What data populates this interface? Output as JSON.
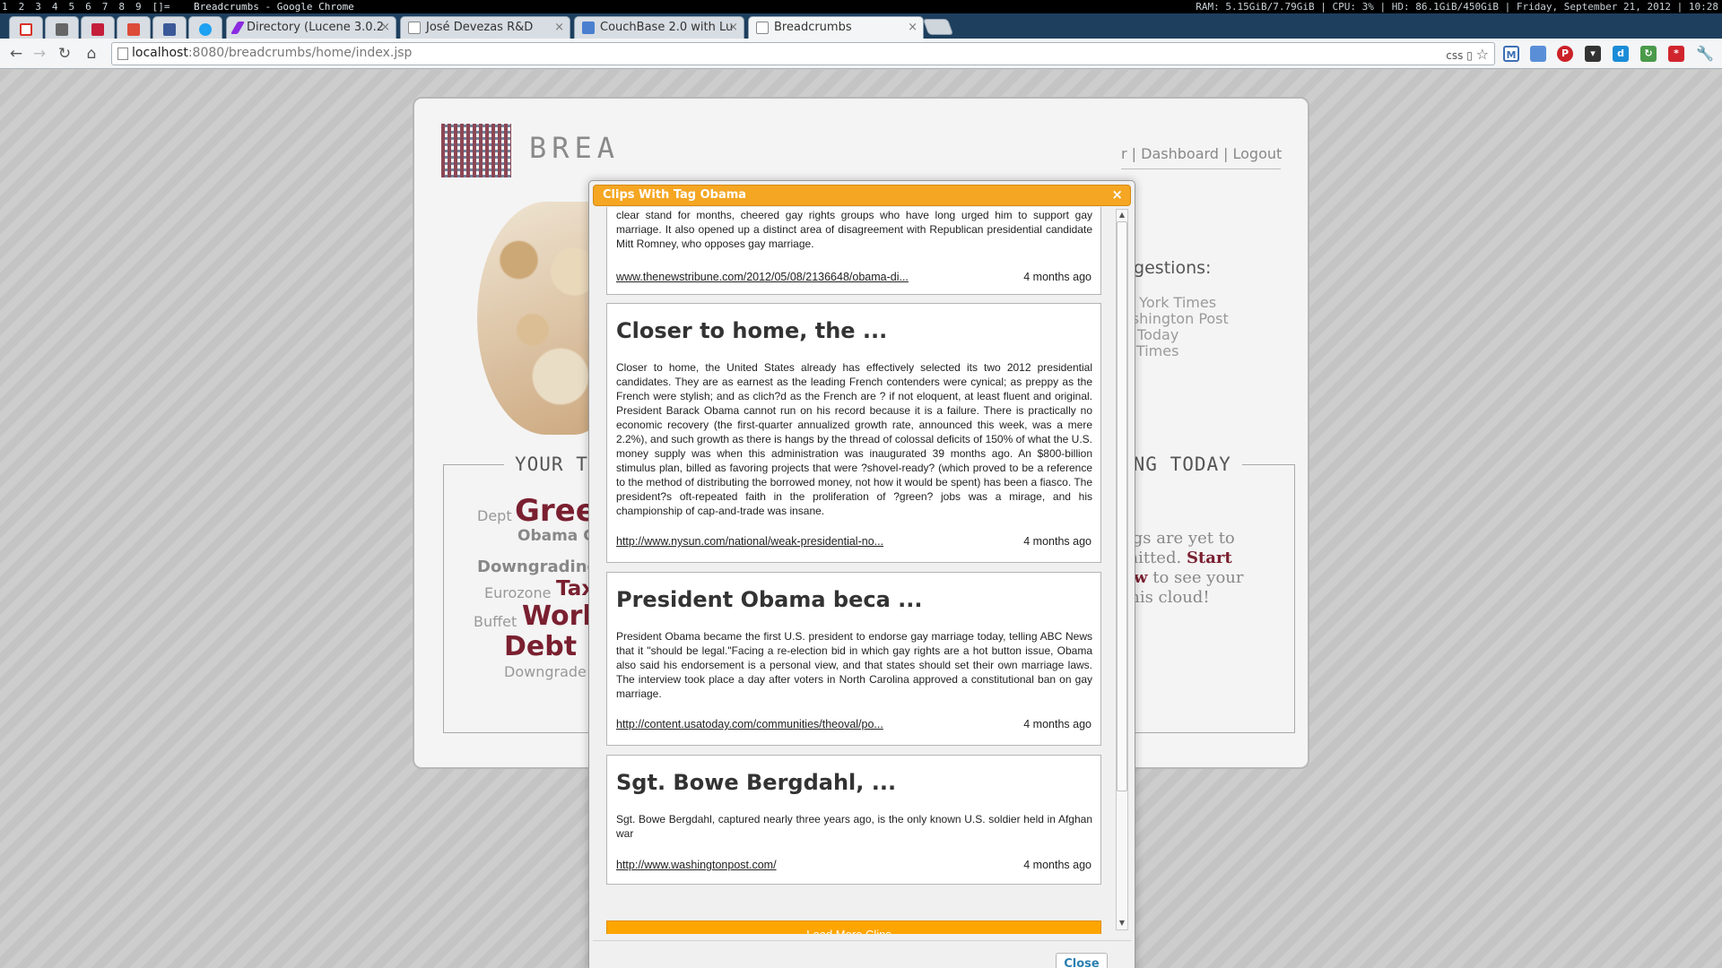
{
  "wm": {
    "workspaces": [
      "1",
      "2",
      "3",
      "4",
      "5",
      "6",
      "7",
      "8",
      "9",
      "[]="
    ],
    "window_title": "Breadcrumbs - Google Chrome",
    "status": "RAM: 5.15GiB/7.79GiB | CPU: 3% | HD: 86.1GiB/450GiB | Friday, September 21, 2012 | 10:28"
  },
  "tabs": [
    {
      "label": "",
      "icon": "gmail-icon",
      "color": "#d93025"
    },
    {
      "label": "",
      "icon": "calendar-icon",
      "color": "#555555"
    },
    {
      "label": "",
      "icon": "lastfm-icon",
      "color": "#c41e3a"
    },
    {
      "label": "",
      "icon": "google-plus-icon",
      "color": "#dd4b39"
    },
    {
      "label": "",
      "icon": "facebook-icon",
      "color": "#3b5998"
    },
    {
      "label": "",
      "icon": "twitter-icon",
      "color": "#1da1f2"
    },
    {
      "label": "Directory (Lucene 3.0.2",
      "icon": "feather-icon",
      "color": "#8a2be2"
    },
    {
      "label": "José Devezas R&D",
      "icon": "page-icon",
      "color": "#888888"
    },
    {
      "label": "CouchBase 2.0 with Lu",
      "icon": "docs-icon",
      "color": "#4a7fd0"
    },
    {
      "label": "Breadcrumbs",
      "icon": "page-icon",
      "color": "#888888",
      "active": true
    }
  ],
  "toolbar": {
    "url_host": "localhost",
    "url_path": ":8080/breadcrumbs/home/index.jsp",
    "omni_icons": "css"
  },
  "site": {
    "brand": "BREA",
    "nav": "r | Dashboard | Logout",
    "suggestions_title": "ggestions:",
    "suggestions": [
      "w York Times",
      "ashington Post",
      "A Today",
      "e Times"
    ],
    "cloud_title": "YOUR T",
    "today_title": "ING TODAY",
    "cloud_words": [
      {
        "text": "Dept"
      },
      {
        "text": "Greei"
      },
      {
        "text": "Obama G"
      },
      {
        "text": "Downgrading"
      },
      {
        "text": "Eurozone"
      },
      {
        "text": "Tax"
      },
      {
        "text": "Buffet"
      },
      {
        "text": "Worl"
      },
      {
        "text": "Debt L"
      },
      {
        "text": "Downgrade"
      }
    ],
    "empty_msg_1": "ags are yet to",
    "empty_msg_2": "mitted.",
    "empty_msg_start": "Start",
    "empty_msg_now": "ow",
    "empty_msg_3": "to see your",
    "empty_msg_4": "this cloud!"
  },
  "modal": {
    "title": "Clips With Tag Obama",
    "close_x": "×",
    "clips": [
      {
        "title": "",
        "body": "clear stand for months, cheered gay rights groups who have long urged him to support gay marriage. It also opened up a distinct area of disagreement with Republican presidential candidate Mitt Romney, who opposes gay marriage.",
        "link": "www.thenewstribune.com/2012/05/08/2136648/obama-di...",
        "time": "4 months ago"
      },
      {
        "title": "Closer to home, the ...",
        "body": "Closer to home, the United States already has effectively selected its two 2012 presidential candidates. They are as earnest as the leading French contenders were cynical; as preppy as the French were stylish; and as clich?d as the French are ? if not eloquent, at least fluent and original. President Barack Obama cannot run on his record because it is a failure. There is practically no economic recovery (the first-quarter annualized growth rate, announced this week, was a mere 2.2%), and such growth as there is hangs by the thread of colossal deficits of 150% of what the U.S. money supply was when this administration was inaugurated 39 months ago. An $800-billion stimulus plan, billed as favoring projects that were ?shovel-ready? (which proved to be a reference to the method of distributing the borrowed money, not how it would be spent) has been a fiasco. The president?s oft-repeated faith in the proliferation of ?green? jobs was a mirage, and his championship of cap-and-trade was insane.",
        "link": "http://www.nysun.com/national/weak-presidential-no...",
        "time": "4 months ago"
      },
      {
        "title": "President Obama beca ...",
        "body": "President Obama became the first U.S. president to endorse gay marriage today, telling ABC News that it \"should be legal.\"Facing a re-election bid in which gay rights are a hot button issue, Obama also said his endorsement is a personal view, and that states should set their own marriage laws. The interview took place a day after voters in North Carolina approved a constitutional ban on gay marriage.",
        "link": "http://content.usatoday.com/communities/theoval/po...",
        "time": "4 months ago"
      },
      {
        "title": "Sgt. Bowe Bergdahl, ...",
        "body": "Sgt. Bowe Bergdahl, captured nearly three years ago, is the only known U.S. soldier held in Afghan war",
        "link": "http://www.washingtonpost.com/",
        "time": "4 months ago"
      }
    ],
    "load_more": "Load More Clips...",
    "close_button": "Close"
  },
  "colors": {
    "accent_orange": "#ffa500",
    "header_orange": "#f5a623",
    "cloud_red": "#7a2030",
    "link_blue": "#2a7fb0"
  }
}
